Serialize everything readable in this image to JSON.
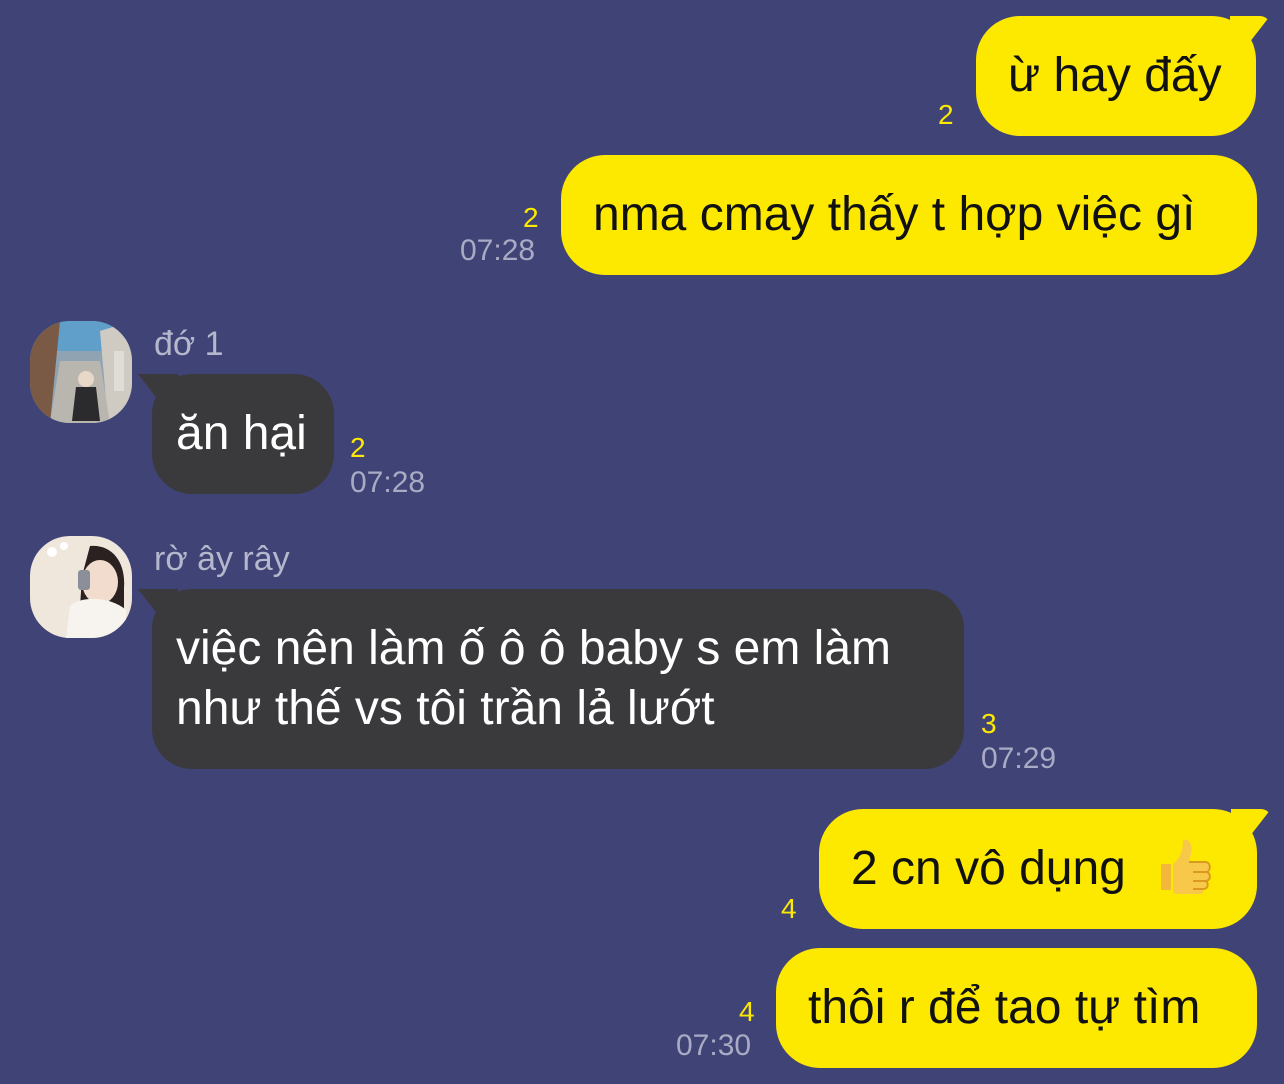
{
  "colors": {
    "background": "#3f4375",
    "my_bubble": "#fde800",
    "their_bubble": "#3a3a3c",
    "unread_count": "#fde800",
    "timestamp": "#a9abc4"
  },
  "messages": [
    {
      "id": "m1",
      "from": "me",
      "text": "ừ hay đấy",
      "unread": "2",
      "time": ""
    },
    {
      "id": "m2",
      "from": "me",
      "text": "nma cmay thấy t hợp việc gì",
      "unread": "2",
      "time": "07:28"
    },
    {
      "id": "m3",
      "from": "đớ 1",
      "avatar": "street-photo-avatar",
      "text": "ăn hại",
      "unread": "2",
      "time": "07:28"
    },
    {
      "id": "m4",
      "from": "rờ ây rây",
      "avatar": "selfie-avatar",
      "text_lines": [
        "việc nên làm ố ô ô baby s em làm",
        "như thế vs tôi trần lả lướt"
      ],
      "unread": "3",
      "time": "07:29"
    },
    {
      "id": "m5",
      "from": "me",
      "text": "2 cn vô dụng",
      "emoji": "thumbs-up-icon",
      "unread": "4",
      "time": ""
    },
    {
      "id": "m6",
      "from": "me",
      "text": "thôi r để tao tự tìm",
      "unread": "4",
      "time": "07:30"
    }
  ]
}
